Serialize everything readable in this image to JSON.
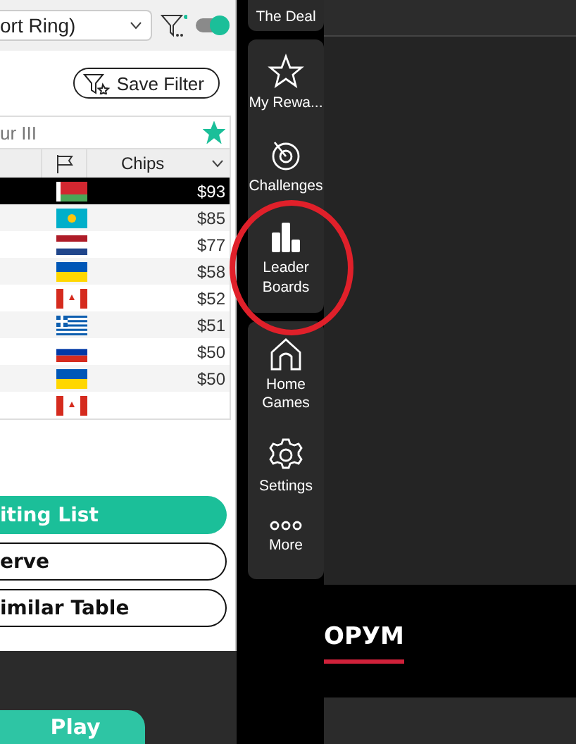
{
  "lobby": {
    "game_select": "ort Ring)",
    "filter_toggle_on": true,
    "save_filter": "Save Filter",
    "table_name": "ur III",
    "favorite": true,
    "columns": [
      {
        "label": "Chips"
      }
    ],
    "rows": [
      {
        "kind": "by",
        "chips": "$93",
        "selected": true
      },
      {
        "kind": "kz",
        "chips": "$85",
        "selected": false
      },
      {
        "kind": "nl",
        "chips": "$77",
        "selected": false
      },
      {
        "kind": "ua",
        "chips": "$58",
        "selected": false
      },
      {
        "kind": "ca",
        "chips": "$52",
        "selected": false
      },
      {
        "kind": "gr",
        "chips": "$51",
        "selected": false
      },
      {
        "kind": "ru",
        "chips": "$50",
        "selected": false
      },
      {
        "kind": "ua",
        "chips": "$50",
        "selected": false
      },
      {
        "kind": "ca",
        "selected": false
      }
    ],
    "buttons": [
      {
        "label": "iting List",
        "kind": "primary"
      },
      {
        "label": "erve",
        "kind": "outline"
      },
      {
        "label": "imilar Table",
        "kind": "outline"
      }
    ],
    "play": "Play"
  },
  "sidebar": {
    "top_item": "The Deal",
    "groups": [
      [
        {
          "kind": "star",
          "label": "My Rewa..."
        },
        {
          "kind": "target",
          "label": "Challenges"
        },
        {
          "kind": "bars",
          "label": "Leader Boards",
          "highlighted": true
        }
      ],
      [
        {
          "kind": "home",
          "label": "Home Games"
        },
        {
          "kind": "gear",
          "label": "Settings"
        },
        {
          "kind": "dots",
          "label": "More"
        }
      ]
    ]
  },
  "banner": {
    "tab": "ОРУМ"
  }
}
